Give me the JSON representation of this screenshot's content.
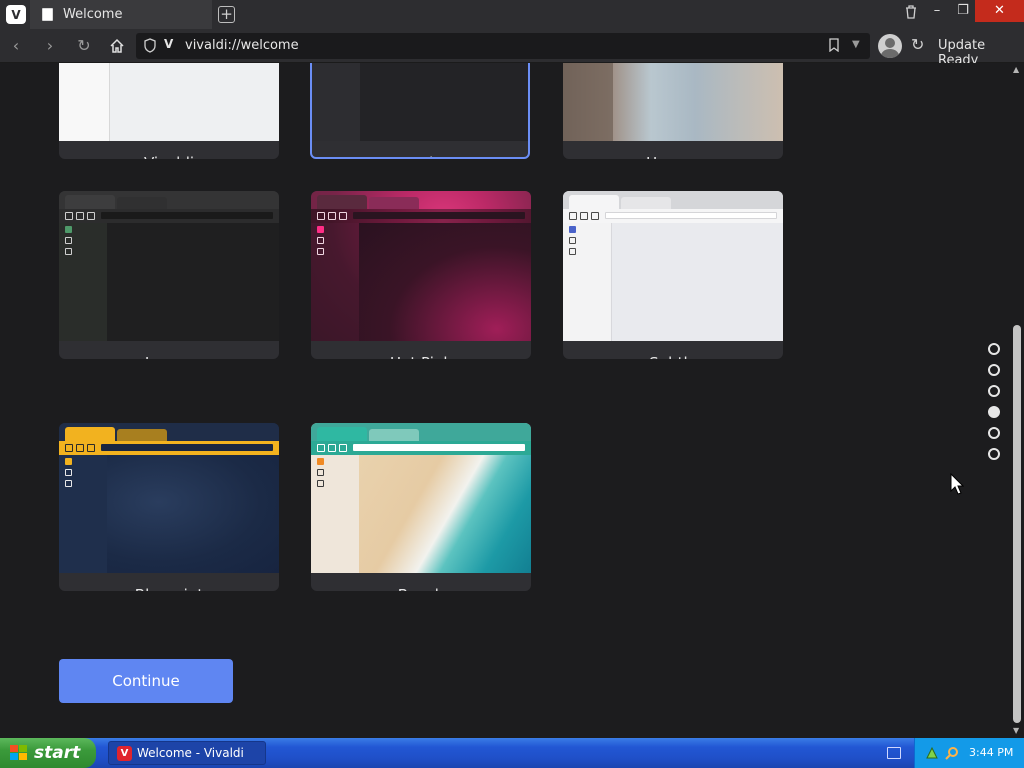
{
  "browser": {
    "tab_title": "Welcome",
    "url": "vivaldi://welcome",
    "update_label": "Update Ready"
  },
  "themes": [
    {
      "name": "Vivaldi",
      "selected": false
    },
    {
      "name": "Dark",
      "selected": true
    },
    {
      "name": "Human",
      "selected": false
    },
    {
      "name": "Issuna",
      "selected": false
    },
    {
      "name": "Hot Pink",
      "selected": false
    },
    {
      "name": "Subtle",
      "selected": false
    },
    {
      "name": "Blueprint",
      "selected": false
    },
    {
      "name": "Beach",
      "selected": false
    }
  ],
  "continue_label": "Continue",
  "pager": {
    "count": 6,
    "active_index": 3
  },
  "taskbar": {
    "start_label": "start",
    "task_label": "Welcome - Vivaldi",
    "clock": "3:44 PM"
  },
  "colors": {
    "accent": "#5f86f2",
    "selected_border": "#6b8ef5",
    "background": "#1c1c1e"
  }
}
